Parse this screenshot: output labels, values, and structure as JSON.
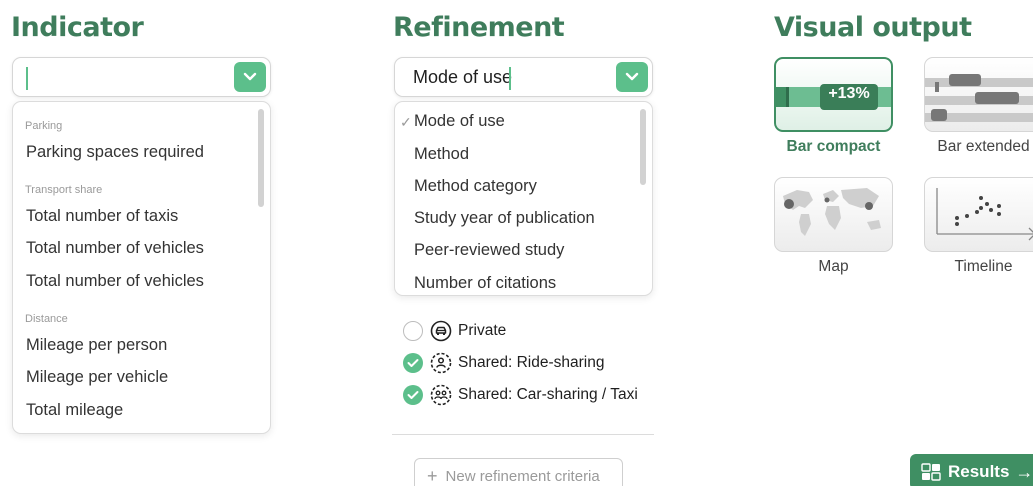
{
  "indicator": {
    "title": "Indicator",
    "select_value": "",
    "groups": [
      {
        "label": "Parking",
        "options": [
          "Parking spaces required"
        ]
      },
      {
        "label": "Transport share",
        "options": [
          "Total number of taxis",
          "Total number of vehicles",
          "Total number of vehicles"
        ]
      },
      {
        "label": "Distance",
        "options": [
          "Mileage per person",
          "Mileage per vehicle",
          "Total mileage"
        ]
      }
    ]
  },
  "refinement": {
    "title": "Refinement",
    "select_value": "Mode of use",
    "options": [
      "Mode of use",
      "Method",
      "Method category",
      "Study year of publication",
      "Peer-reviewed study",
      "Number of citations"
    ],
    "selected_index": 0,
    "selected_mark": "✓",
    "modes": [
      {
        "label": "Private",
        "checked": false,
        "icon": "car-icon"
      },
      {
        "label": "Shared: Ride-sharing",
        "checked": true,
        "icon": "person-icon"
      },
      {
        "label": "Shared: Car-sharing / Taxi",
        "checked": true,
        "icon": "group-icon"
      }
    ],
    "new_criteria_label": "New refinement criteria",
    "new_criteria_plus": "+"
  },
  "visual_output": {
    "title": "Visual output",
    "options": [
      {
        "label": "Bar compact",
        "selected": true,
        "badge": "+13%"
      },
      {
        "label": "Bar extended",
        "selected": false
      },
      {
        "label": "Map",
        "selected": false
      },
      {
        "label": "Timeline",
        "selected": false
      }
    ]
  },
  "results_button": {
    "label": "Results",
    "arrow": "→"
  },
  "colors": {
    "accent": "#5cbf8b",
    "accent_dark": "#3f8f63",
    "title_green": "#3f7d5c"
  }
}
